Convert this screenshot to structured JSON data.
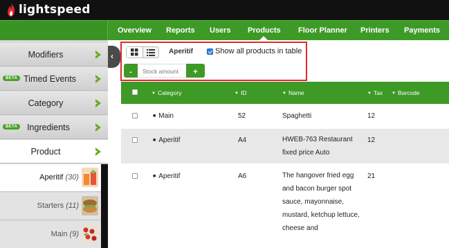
{
  "brand": {
    "name": "lightspeed",
    "icon": "flame-icon"
  },
  "nav": {
    "tabs": [
      {
        "label": "Overview"
      },
      {
        "label": "Reports"
      },
      {
        "label": "Users"
      },
      {
        "label": "Products",
        "active": true
      },
      {
        "label": "Floor Planner"
      },
      {
        "label": "Printers"
      },
      {
        "label": "Payments"
      }
    ]
  },
  "sidebar": {
    "items": [
      {
        "label": "Modifiers",
        "beta": false
      },
      {
        "label": "Timed Events",
        "beta": true
      },
      {
        "label": "Category",
        "beta": false
      },
      {
        "label": "Ingredients",
        "beta": true
      },
      {
        "label": "Product",
        "beta": false,
        "selected": true
      }
    ],
    "beta_label": "BETA",
    "subitems": [
      {
        "label": "Aperitif",
        "count": "(30)",
        "selected": true
      },
      {
        "label": "Starters",
        "count": "(11)"
      },
      {
        "label": "Main",
        "count": "(9)"
      }
    ]
  },
  "toolbar": {
    "breadcrumb": "Aperitif",
    "show_all_label": "Show all products in table",
    "show_all_checked": true,
    "stock_placeholder": "Stock amount",
    "minus_label": "-",
    "plus_label": "+"
  },
  "table": {
    "columns": [
      "Category",
      "ID",
      "Name",
      "Tax",
      "Barcode"
    ],
    "rows": [
      {
        "category": "Main",
        "id": "52",
        "name": "Spaghetti",
        "tax": "12",
        "barcode": ""
      },
      {
        "category": "Aperitif",
        "id": "A4",
        "name": "HWEB-763 Restaurant fixed price Auto",
        "tax": "12",
        "barcode": ""
      },
      {
        "category": "Aperitif",
        "id": "A6",
        "name": "The hangover fried egg and bacon burger spot sauce, mayonnaise, mustard, ketchup lettuce, cheese and",
        "tax": "21",
        "barcode": ""
      }
    ]
  },
  "colors": {
    "accent": "#3d9a26",
    "highlight": "#e2262d",
    "topbar": "#111111"
  }
}
